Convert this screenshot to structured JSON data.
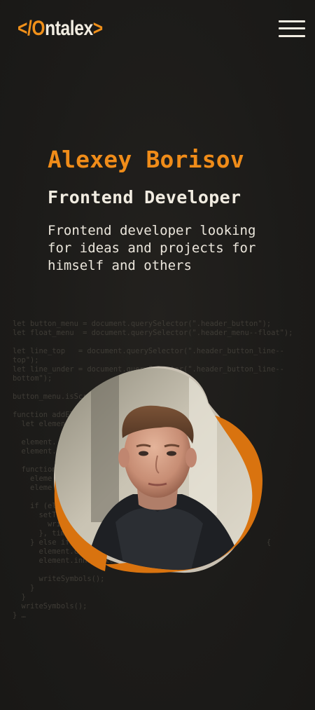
{
  "header": {
    "logo": {
      "open_bracket": "</",
      "initial": "O",
      "rest": "ntalex",
      "close_bracket": ">"
    },
    "menu_icon": "hamburger-menu-icon"
  },
  "hero": {
    "name": "Alexey Borisov",
    "role": "Frontend Developer",
    "description": "Frontend developer looking for ideas and projects for himself and others"
  },
  "code_snippet": "let button_menu = document.querySelector(\".header_button\");\nlet float_menu  = document.querySelector(\".header_menu--float\");\n\nlet line_top   = document.querySelector(\".header_button_line--\ntop\");\nlet line_under = document.querySelector(\".header_button_line--\nbottom\");\n\nbutton_menu.isScrolled\n\nfunction addElem\n  let element\n\n  element.\n  element.\n\n  function\n    eleme\n    eleme\n\n    if (ele\n      setTim\n        write\n      }, time\n    } else if (ele                                        {\n      element.count\n      element.innerText\n\n      writeSymbols();\n    }\n  }\n  writeSymbols();\n} …",
  "colors": {
    "accent": "#f08c19",
    "background": "#1d1c1a",
    "text": "#f1ece1",
    "code": "#3f3c36",
    "blob_light": "#c9c1b3",
    "blob_orange": "#d9730f"
  }
}
